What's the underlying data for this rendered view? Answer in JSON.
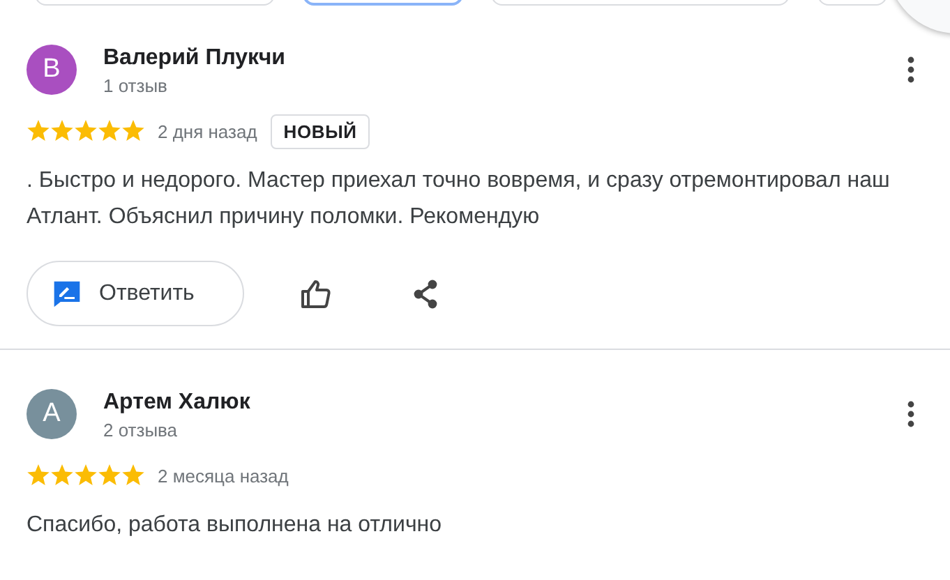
{
  "filter_chips": [
    {
      "selected": false
    },
    {
      "selected": true
    },
    {
      "selected": false
    },
    {
      "selected": false
    }
  ],
  "reviews": [
    {
      "avatar_letter": "В",
      "color": "#a94fc0",
      "name": "Валерий Плукчи",
      "review_count": "1 отзыв",
      "stars": 5,
      "date": "2 дня назад",
      "badge": "НОВЫЙ",
      "text": ". Быстро и недорого. Мастер приехал точно вовремя, и сразу отремонтировал наш Атлант. Объяснил причину поломки. Рекомендую",
      "reply_button": "Ответить"
    },
    {
      "avatar_letter": "А",
      "color": "#78909c",
      "name": "Артем Халюк",
      "review_count": "2 отзыва",
      "stars": 5,
      "date": "2 месяца назад",
      "text": "Спасибо, работа выполнена на отлично"
    }
  ]
}
